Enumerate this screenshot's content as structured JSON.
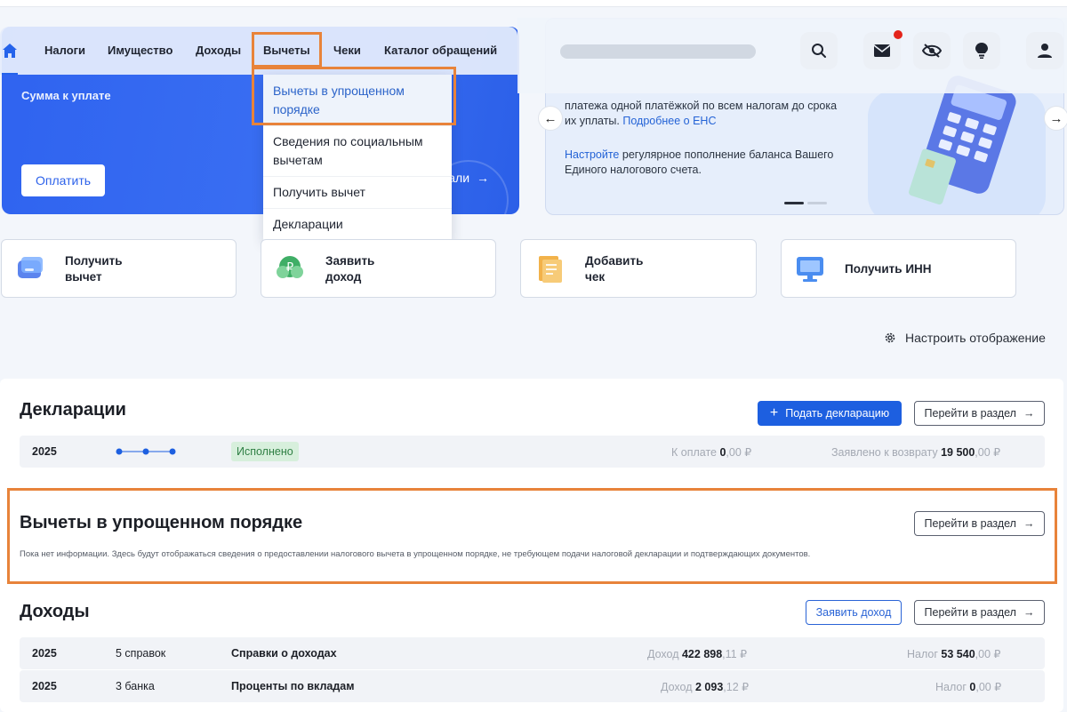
{
  "nav": {
    "items": [
      "Налоги",
      "Имущество",
      "Доходы",
      "Вычеты",
      "Чеки",
      "Каталог обращений"
    ],
    "active": "Вычеты"
  },
  "dropdown": {
    "items": [
      "Вычеты в упрощенном порядке",
      "Сведения по социальным вычетам",
      "Получить вычет",
      "Декларации"
    ]
  },
  "hero_left": {
    "sum_label": "Сумма к уплате",
    "pay_button": "Оплатить",
    "details_link": "тали"
  },
  "hero_right": {
    "p1_text": "платежа одной платёжкой по всем налогам до срока их уплаты.",
    "p1_link": "Подробнее о ЕНС",
    "p2_link": "Настройте",
    "p2_text": "регулярное пополнение баланса Вашего Единого налогового счета."
  },
  "quick_actions": [
    {
      "label_line1": "Получить",
      "label_line2": "вычет",
      "icon": "deduction-card-icon"
    },
    {
      "label_line1": "Заявить",
      "label_line2": "доход",
      "icon": "income-ruble-icon"
    },
    {
      "label_line1": "Добавить",
      "label_line2": "чек",
      "icon": "receipt-icon"
    },
    {
      "label_line1": "Получить ИНН",
      "label_line2": "",
      "icon": "inn-monitor-icon"
    }
  ],
  "settings_link": "Настроить отображение",
  "declarations": {
    "title": "Декларации",
    "submit_button": "Подать декларацию",
    "go_button": "Перейти в раздел",
    "row": {
      "year": "2025",
      "status": "Исполнено",
      "to_pay_label": "К оплате",
      "to_pay_int": "0",
      "to_pay_frac": ",00 ₽",
      "refund_label": "Заявлено к возврату",
      "refund_int": "19 500",
      "refund_frac": ",00 ₽"
    }
  },
  "simplified": {
    "title": "Вычеты в упрощенном порядке",
    "go_button": "Перейти в раздел",
    "info": "Пока нет информации. Здесь будут отображаться сведения о предоставлении налогового вычета в упрощенном порядке, не требующем подачи налоговой декларации и подтверждающих документов."
  },
  "income": {
    "title": "Доходы",
    "declare_button": "Заявить доход",
    "go_button": "Перейти в раздел",
    "rows": [
      {
        "year": "2025",
        "count": "5 справок",
        "name": "Справки о доходах",
        "income_label": "Доход",
        "income_int": "422 898",
        "income_frac": ",11 ₽",
        "tax_label": "Налог",
        "tax_int": "53 540",
        "tax_frac": ",00 ₽"
      },
      {
        "year": "2025",
        "count": "3 банка",
        "name": "Проценты по вкладам",
        "income_label": "Доход",
        "income_int": "2 093",
        "income_frac": ",12 ₽",
        "tax_label": "Налог",
        "tax_int": "0",
        "tax_frac": ",00 ₽"
      }
    ]
  },
  "colors": {
    "accent": "#1d5fe0",
    "highlight": "#e8833a",
    "hero_blue": "#2f63f0",
    "notification": "#e3241b"
  }
}
